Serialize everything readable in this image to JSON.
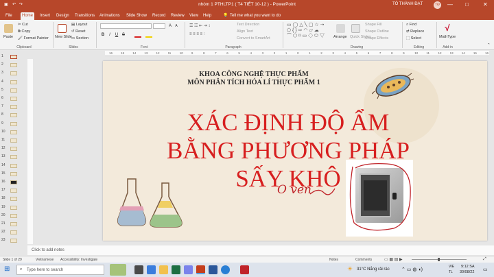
{
  "window": {
    "title": "nhóm 1 PTHLTP1 ( T4 TIẾT 10-12 )  -  PowerPoint",
    "user": "TÔ THÀNH ĐẠT",
    "user_initials": "TĐ",
    "minimize": "—",
    "maximize": "□",
    "close": "✕"
  },
  "tabs": [
    "File",
    "Home",
    "Insert",
    "Design",
    "Transitions",
    "Animations",
    "Slide Show",
    "Record",
    "Review",
    "View",
    "Help"
  ],
  "active_tab": "Home",
  "tell_me": "Tell me what you want to do",
  "ribbon": {
    "clipboard": {
      "paste": "Paste",
      "cut": "Cut",
      "copy": "Copy",
      "format_painter": "Format Painter",
      "label": "Clipboard"
    },
    "slides": {
      "new_slide": "New Slide",
      "layout": "Layout",
      "reset": "Reset",
      "section": "Section",
      "label": "Slides"
    },
    "font": {
      "label": "Font",
      "bold": "B",
      "italic": "I",
      "underline": "U",
      "strike": "S",
      "aa_big": "A",
      "aa_small": "A"
    },
    "paragraph": {
      "label": "Paragraph",
      "text_direction": "Text Direction",
      "align_text": "Align Text",
      "convert_smartart": "Convert to SmartArt"
    },
    "drawing": {
      "label": "Drawing",
      "arrange": "Arrange",
      "quick_styles": "Quick Styles",
      "shape_fill": "Shape Fill",
      "shape_outline": "Shape Outline",
      "shape_effects": "Shape Effects"
    },
    "editing": {
      "label": "Editing",
      "find": "Find",
      "replace": "Replace",
      "select": "Select"
    },
    "addins": {
      "label": "Add-in",
      "mathtype": "MathType"
    }
  },
  "ruler_ticks": [
    "16",
    "15",
    "14",
    "13",
    "12",
    "11",
    "10",
    "9",
    "8",
    "7",
    "6",
    "5",
    "4",
    "3",
    "2",
    "1",
    "0",
    "1",
    "2",
    "3",
    "4",
    "5",
    "6",
    "7",
    "8",
    "9",
    "10",
    "11",
    "12",
    "13",
    "14",
    "15",
    "16"
  ],
  "thumbnails": [
    "1",
    "2",
    "3",
    "4",
    "5",
    "6",
    "7",
    "8",
    "9",
    "10",
    "11",
    "12",
    "13",
    "14",
    "15",
    "16",
    "17",
    "18",
    "19",
    "20",
    "21",
    "22",
    "23"
  ],
  "slide": {
    "header1": "KHOA CÔNG NGHỆ THỰC PHẨM",
    "header2": "MÔN PHÂN TÍCH HÓA LÍ THỰC PHẨM 1",
    "line1": "XÁC ĐỊNH ĐỘ ẨM",
    "line2": "BẰNG PHƯƠNG PHÁP",
    "line3": "SẤY KHÔ",
    "handwriting": "O ven"
  },
  "notes_placeholder": "Click to add notes",
  "status": {
    "slide_count": "Slide 1 of 29",
    "language": "Vietnamese",
    "accessibility": "Accessibility: Investigate",
    "notes": "Notes",
    "comments": "Comments"
  },
  "taskbar": {
    "search_placeholder": "Type here to search",
    "weather": "31°C  Nắng rải rác",
    "lang_top": "VIE",
    "lang_bottom": "TL",
    "time": "9:12 SA",
    "date": "30/08/22"
  },
  "colors": {
    "accent": "#b7472a",
    "slide_bg": "#f3eadb",
    "title_red": "#d71f1f"
  }
}
